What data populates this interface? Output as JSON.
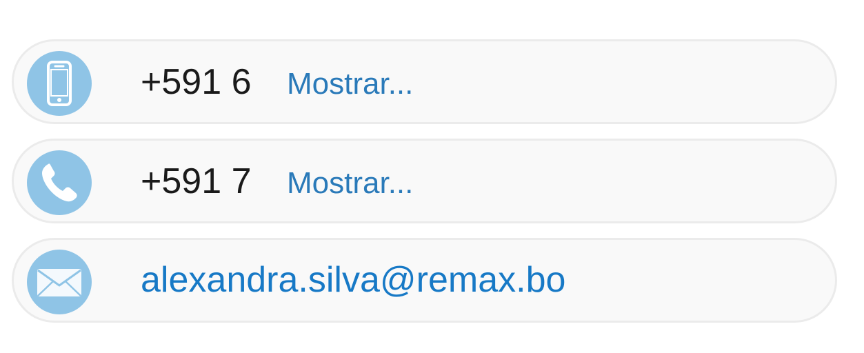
{
  "contacts": {
    "mobile": {
      "icon": "smartphone-icon",
      "number": "+591 6",
      "show_label": "Mostrar..."
    },
    "phone": {
      "icon": "phone-handset-icon",
      "number": "+591 7",
      "show_label": "Mostrar..."
    },
    "email": {
      "icon": "envelope-icon",
      "address": "alexandra.silva@remax.bo"
    }
  },
  "colors": {
    "icon_background": "#8fc4e6",
    "link": "#2a7ab9",
    "email_link": "#1779c6",
    "row_background": "#f9f9f9",
    "row_border": "#ebebeb",
    "number_text": "#1a1a1a"
  }
}
